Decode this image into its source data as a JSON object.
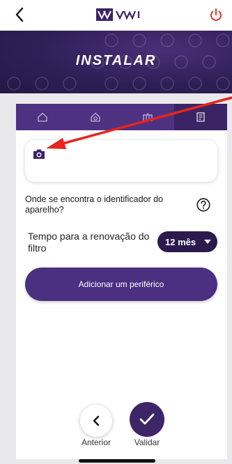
{
  "header": {
    "back_icon": "chevron-left-icon",
    "logo_text": "VMI",
    "power_icon": "power-icon"
  },
  "banner": {
    "title": "INSTALAR"
  },
  "tabs": [
    {
      "icon": "home-icon",
      "active": false
    },
    {
      "icon": "house-gear-icon",
      "active": false
    },
    {
      "icon": "fan-unit-icon",
      "active": false
    },
    {
      "icon": "device-panel-icon",
      "active": true
    }
  ],
  "photo": {
    "icon": "camera-icon"
  },
  "identifier": {
    "question": "Onde se encontra o identificador do aparelho?",
    "help_icon": "question-circle-icon"
  },
  "renewal": {
    "label": "Tempo para a renovação do filtro",
    "selected": "12 mês"
  },
  "add_peripheral": {
    "label": "Adicionar um periférico"
  },
  "navigation": {
    "previous_label": "Anterior",
    "validate_label": "Validar"
  },
  "colors": {
    "primary": "#4b2f80",
    "dark": "#2a1a4e",
    "power": "#e0342a",
    "annotation_arrow": "#e8241c"
  }
}
